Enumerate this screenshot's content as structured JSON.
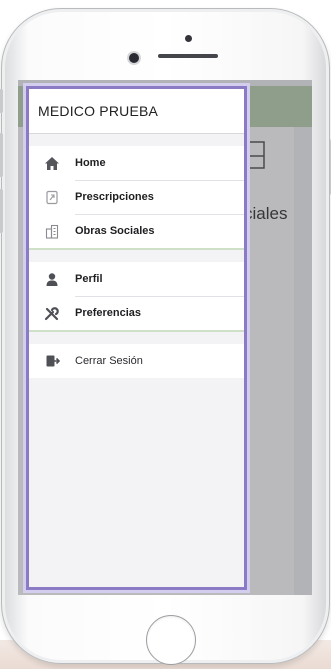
{
  "drawer": {
    "title": "MEDICO PRUEBA",
    "groups": [
      {
        "items": [
          {
            "label": "Home",
            "icon": "home-icon"
          },
          {
            "label": "Prescripciones",
            "icon": "prescription-icon"
          },
          {
            "label": "Obras Sociales",
            "icon": "building-icon"
          }
        ]
      },
      {
        "items": [
          {
            "label": "Perfil",
            "icon": "user-icon"
          },
          {
            "label": "Preferencias",
            "icon": "tools-icon"
          }
        ]
      },
      {
        "items": [
          {
            "label": "Cerrar Sesión",
            "icon": "sign-out-icon"
          }
        ]
      }
    ]
  },
  "background_screen": {
    "visible_text": "ciales"
  },
  "colors": {
    "drawer_border": "#8b7bc4",
    "app_bar": "#8e9f88",
    "group_separator": "#cfe0c9"
  }
}
